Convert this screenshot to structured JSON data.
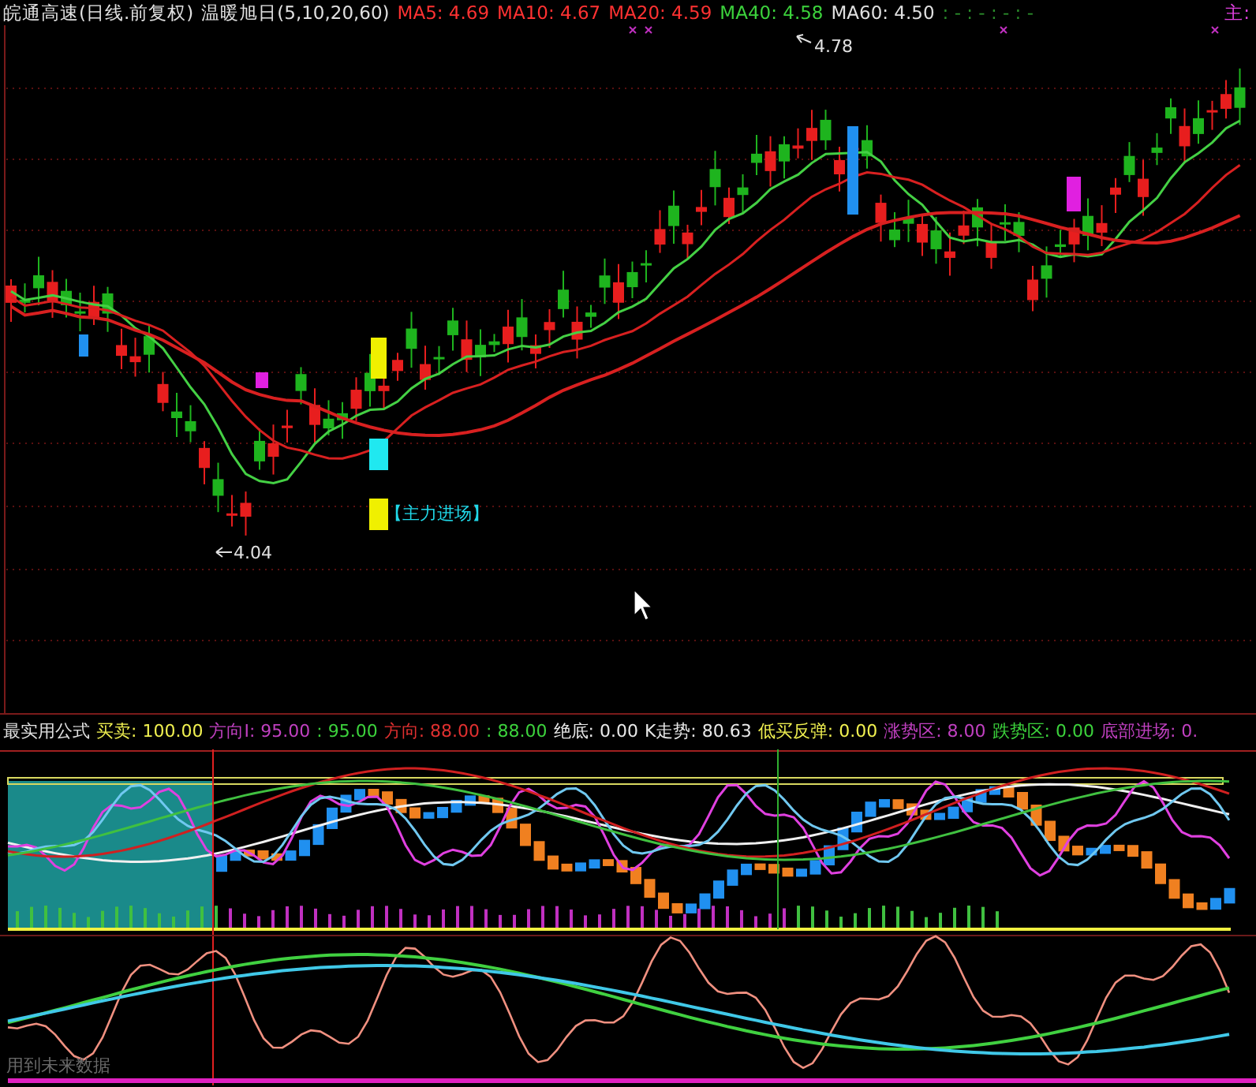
{
  "main_chart": {
    "title": "皖通高速(日线.前复权)",
    "indicator": "温暖旭日(5,10,20,60)",
    "ma_values": [
      {
        "text": "MA5: 4.69",
        "color": "#ff3232"
      },
      {
        "text": "MA10: 4.67",
        "color": "#ff3232"
      },
      {
        "text": "MA20: 4.59",
        "color": "#ff3232"
      },
      {
        "text": "MA40: 4.58",
        "color": "#3cd23c"
      },
      {
        "text": "MA60: 4.50",
        "color": "#e0e0e0"
      }
    ],
    "empty_values": ": - : - : - : -",
    "corner_label": "主:",
    "high_label": "4.78",
    "low_label": "4.04",
    "signal_label": "【主力进场】"
  },
  "sub_chart": {
    "title": "最实用公式",
    "values": [
      {
        "text": "买卖: 100.00",
        "color": "#f0f050"
      },
      {
        "text": "方向I: 95.00",
        "color": "#c040c0"
      },
      {
        "text": ": 95.00",
        "color": "#3cd23c"
      },
      {
        "text": "方向: 88.00",
        "color": "#e03030"
      },
      {
        "text": ": 88.00",
        "color": "#3cd23c"
      },
      {
        "text": "绝底: 0.00",
        "color": "#e8e8e8"
      },
      {
        "text": "K走势: 80.63",
        "color": "#e8e8e8"
      },
      {
        "text": "低买反弹: 0.00",
        "color": "#f0f050"
      },
      {
        "text": "涨势区: 8.00",
        "color": "#c040c0"
      },
      {
        "text": "跌势区: 0.00",
        "color": "#3cd23c"
      },
      {
        "text": "底部进场: 0.",
        "color": "#c040c0"
      }
    ],
    "warning": "用到未来数据"
  }
}
